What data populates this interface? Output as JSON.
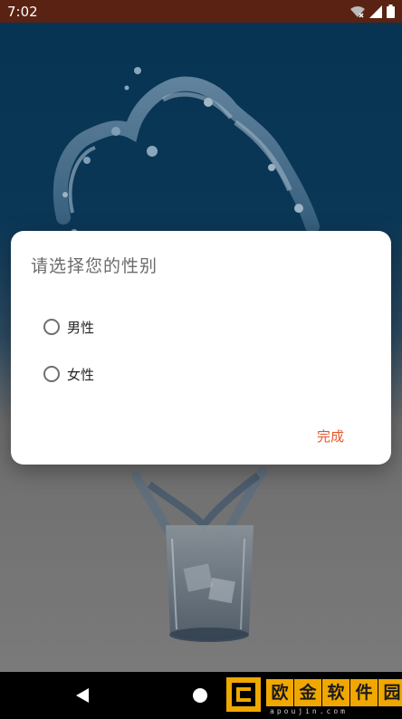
{
  "status_bar": {
    "time": "7:02",
    "icons": [
      "wifi-icon",
      "signal-icon",
      "battery-icon"
    ]
  },
  "dialog": {
    "title": "请选择您的性别",
    "options": [
      {
        "label": "男性",
        "selected": false
      },
      {
        "label": "女性",
        "selected": false
      }
    ],
    "confirm_label": "完成"
  },
  "nav_bar": {
    "buttons": [
      "back",
      "home"
    ]
  },
  "watermark": {
    "chars": [
      "欧",
      "金",
      "软",
      "件",
      "园"
    ],
    "url": "apoujin.com"
  },
  "colors": {
    "status_bar": "#5a2212",
    "accent": "#e2572a",
    "watermark": "#f0a800"
  }
}
